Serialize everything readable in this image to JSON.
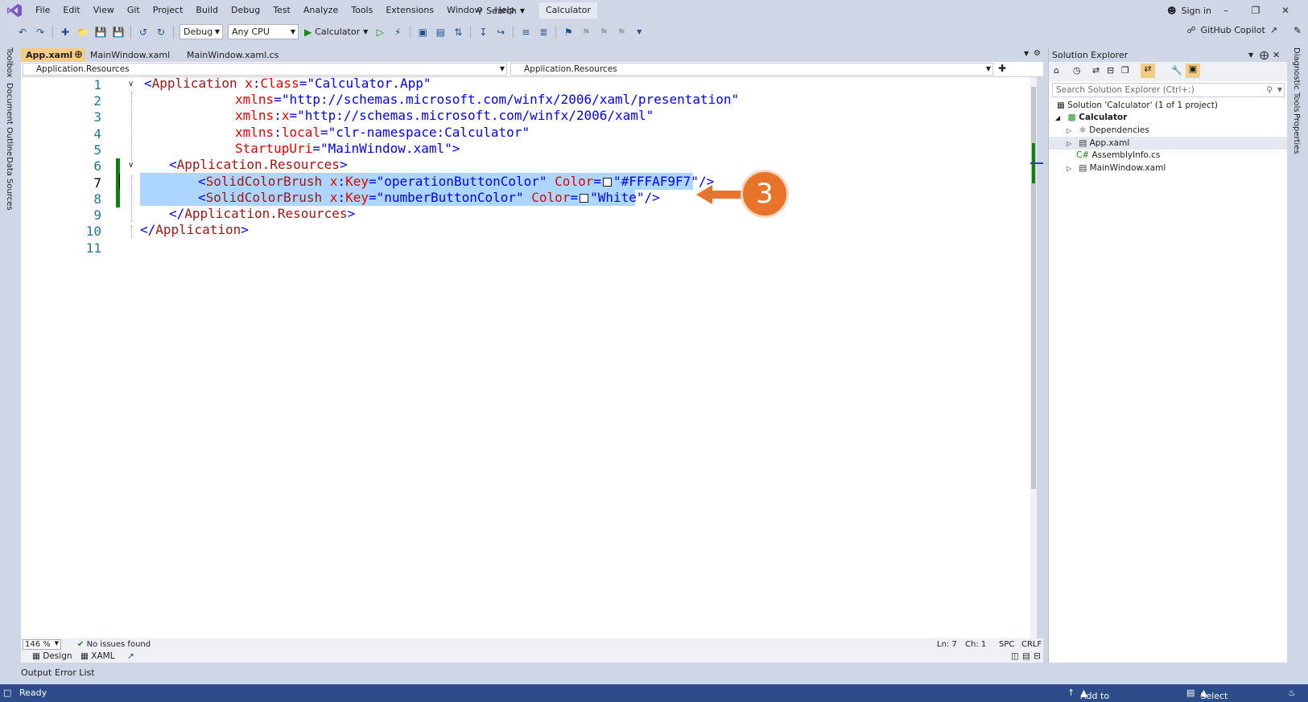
{
  "menu": [
    "File",
    "Edit",
    "View",
    "Git",
    "Project",
    "Build",
    "Debug",
    "Test",
    "Analyze",
    "Tools",
    "Extensions",
    "Window",
    "Help"
  ],
  "search_label": "Search",
  "solution_name": "Calculator",
  "sign_in": "Sign in",
  "toolbar": {
    "config": "Debug",
    "platform": "Any CPU",
    "run_target": "Calculator",
    "copilot": "GitHub Copilot"
  },
  "left_rail": [
    "Toolbox",
    "Document Outline",
    "Data Sources"
  ],
  "right_rail": [
    "Diagnostic Tools",
    "Properties"
  ],
  "tabs": [
    {
      "label": "App.xaml",
      "active": true
    },
    {
      "label": "MainWindow.xaml",
      "active": false
    },
    {
      "label": "MainWindow.xaml.cs",
      "active": false
    }
  ],
  "nav": {
    "left": "Application.Resources",
    "right": "Application.Resources"
  },
  "editor": {
    "line_numbers": [
      "1",
      "2",
      "3",
      "4",
      "5",
      "6",
      "7",
      "8",
      "9",
      "10",
      "11"
    ],
    "current_line": 7,
    "colors": {
      "operationButtonColor": "#FFFAF9F7",
      "numberButtonColor": "White"
    }
  },
  "code": {
    "l1": {
      "open": "<",
      "tag": "Application",
      "attr": "x",
      "colon": ":",
      "attr2": "Class",
      "eq": "=",
      "val": "\"Calculator.App\""
    },
    "l2": {
      "attr": "xmlns",
      "val": "\"http://schemas.microsoft.com/winfx/2006/xaml/presentation\""
    },
    "l3": {
      "attr": "xmlns",
      "colon": ":",
      "attr2": "x",
      "val": "\"http://schemas.microsoft.com/winfx/2006/xaml\""
    },
    "l4": {
      "attr": "xmlns",
      "colon": ":",
      "attr2": "local",
      "val": "\"clr-namespace:Calculator\""
    },
    "l5": {
      "attr": "StartupUri",
      "val": "\"MainWindow.xaml\"",
      "close": ">"
    },
    "l6": {
      "open": "<",
      "tag": "Application.Resources",
      "close": ">"
    },
    "l7": {
      "open": "<",
      "tag": "SolidColorBrush",
      "attr": "x",
      "attr2": "Key",
      "val": "\"operationButtonColor\"",
      "attr3": "Color",
      "val2": "\"#FFFAF9F7\"",
      "close": "/>"
    },
    "l8": {
      "open": "<",
      "tag": "SolidColorBrush",
      "attr": "x",
      "attr2": "Key",
      "val": "\"numberButtonColor\"",
      "attr3": "Color",
      "val2": "\"White\"",
      "close": "/>"
    },
    "l9": {
      "open": "</",
      "tag": "Application.Resources",
      "close": ">"
    },
    "l10": {
      "open": "</",
      "tag": "Application",
      "close": ">"
    }
  },
  "callout": {
    "number": "3",
    "color": "#e8742c"
  },
  "editor_status": {
    "zoom": "146 %",
    "issues": "No issues found",
    "ln": "Ln: 7",
    "ch": "Ch: 1",
    "spc": "SPC",
    "crlf": "CRLF",
    "design": "Design",
    "xaml": "XAML"
  },
  "bottom_tabs": [
    "Output",
    "Error List"
  ],
  "solution_explorer": {
    "title": "Solution Explorer",
    "search_placeholder": "Search Solution Explorer (Ctrl+;)",
    "items": [
      {
        "label": "Solution 'Calculator' (1 of 1 project)",
        "icon": "solution-icon"
      },
      {
        "label": "Calculator",
        "icon": "project-icon"
      },
      {
        "label": "Dependencies",
        "icon": "dependencies-icon"
      },
      {
        "label": "App.xaml",
        "icon": "xaml-file-icon"
      },
      {
        "label": "AssemblyInfo.cs",
        "icon": "csharp-file-icon"
      },
      {
        "label": "MainWindow.xaml",
        "icon": "xaml-file-icon"
      }
    ]
  },
  "statusbar": {
    "ready": "Ready",
    "source_control": "Add to Source Control",
    "repo": "Select Repository"
  }
}
